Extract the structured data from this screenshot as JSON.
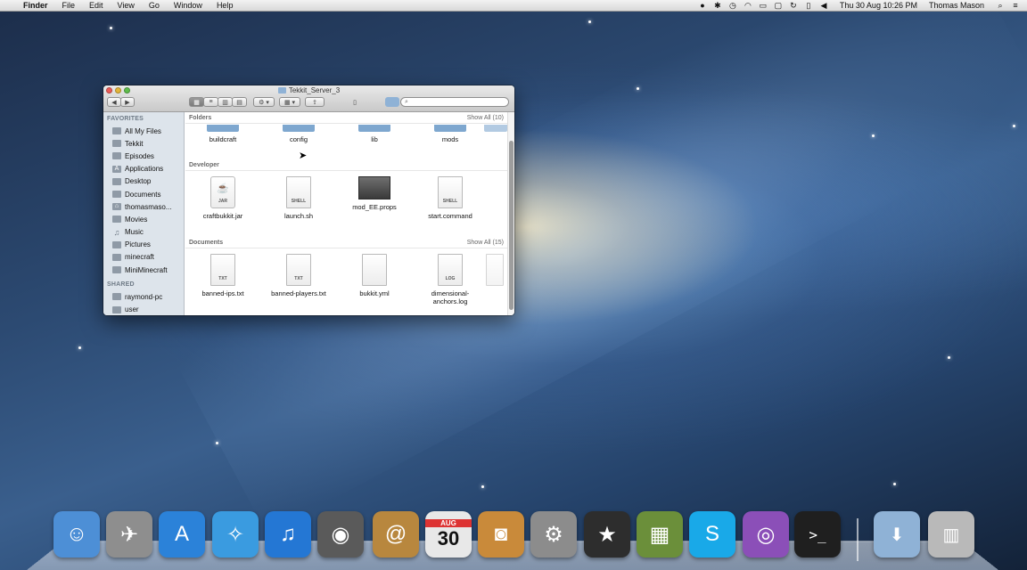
{
  "menubar": {
    "apple_glyph": "",
    "app_name": "Finder",
    "menus": [
      "File",
      "Edit",
      "View",
      "Go",
      "Window",
      "Help"
    ],
    "clock": "Thu 30 Aug  10:26 PM",
    "user": "Thomas Mason",
    "status_icons": [
      "skype-status-icon",
      "bluetooth-icon",
      "time-machine-icon",
      "wifi-icon",
      "airplay-icon",
      "display-icon",
      "sync-icon",
      "battery-icon",
      "volume-icon"
    ]
  },
  "finder": {
    "title": "Tekkit_Server_3",
    "search_placeholder": "",
    "sidebar": {
      "favorites_heading": "FAVORITES",
      "favorites": [
        {
          "label": "All My Files",
          "icon": "all-files-icon",
          "selected": true
        },
        {
          "label": "Tekkit",
          "icon": "folder-icon"
        },
        {
          "label": "Episodes",
          "icon": "folder-icon"
        },
        {
          "label": "Applications",
          "icon": "applications-icon"
        },
        {
          "label": "Desktop",
          "icon": "desktop-icon"
        },
        {
          "label": "Documents",
          "icon": "documents-icon"
        },
        {
          "label": "thomasmaso...",
          "icon": "home-icon"
        },
        {
          "label": "Movies",
          "icon": "movies-icon"
        },
        {
          "label": "Music",
          "icon": "music-icon"
        },
        {
          "label": "Pictures",
          "icon": "pictures-icon"
        },
        {
          "label": "minecraft",
          "icon": "folder-icon"
        },
        {
          "label": "MiniMinecraft",
          "icon": "folder-icon"
        }
      ],
      "shared_heading": "SHARED",
      "shared": [
        {
          "label": "raymond-pc",
          "icon": "computer-icon"
        },
        {
          "label": "user",
          "icon": "computer-icon"
        }
      ]
    },
    "sections": {
      "folders": {
        "heading": "Folders",
        "show_all": "Show All (10)",
        "items": [
          "buildcraft",
          "config",
          "lib",
          "mods"
        ]
      },
      "developer": {
        "heading": "Developer",
        "items": [
          {
            "name": "craftbukkit.jar",
            "tag": "JAR"
          },
          {
            "name": "launch.sh",
            "tag": "SHELL"
          },
          {
            "name": "mod_EE.props",
            "tag": ""
          },
          {
            "name": "start.command",
            "tag": "SHELL"
          }
        ]
      },
      "documents": {
        "heading": "Documents",
        "show_all": "Show All (15)",
        "items": [
          {
            "name": "banned-ips.txt",
            "tag": "TXT"
          },
          {
            "name": "banned-players.txt",
            "tag": "TXT"
          },
          {
            "name": "bukkit.yml",
            "tag": ""
          },
          {
            "name": "dimensional-anchors.log",
            "tag": "LOG"
          }
        ]
      }
    }
  },
  "dock": {
    "apps": [
      {
        "name": "finder-icon",
        "color": "#4d8fd6"
      },
      {
        "name": "launchpad-icon",
        "color": "#8e8e8e"
      },
      {
        "name": "app-store-icon",
        "color": "#2b82d9"
      },
      {
        "name": "safari-icon",
        "color": "#3a9be0"
      },
      {
        "name": "itunes-icon",
        "color": "#2477d4"
      },
      {
        "name": "facetime-icon",
        "color": "#5a5a5a"
      },
      {
        "name": "address-book-icon",
        "color": "#b8873e"
      },
      {
        "name": "ical-icon",
        "color": "#e8e8e8"
      },
      {
        "name": "iphoto-icon",
        "color": "#c98a3a"
      },
      {
        "name": "system-preferences-icon",
        "color": "#8c8c8c"
      },
      {
        "name": "imovie-icon",
        "color": "#2d2d2d"
      },
      {
        "name": "minecraft-icon",
        "color": "#6b8f3a"
      },
      {
        "name": "skype-icon",
        "color": "#19a9e8"
      },
      {
        "name": "podcast-icon",
        "color": "#8b4fb8"
      },
      {
        "name": "terminal-icon",
        "color": "#1f1f1f"
      },
      {
        "name": "downloads-folder-icon",
        "color": "#8fb2d6"
      },
      {
        "name": "trash-icon",
        "color": "#b9b9b9"
      }
    ],
    "calendar_day": "30",
    "calendar_month": "AUG"
  }
}
